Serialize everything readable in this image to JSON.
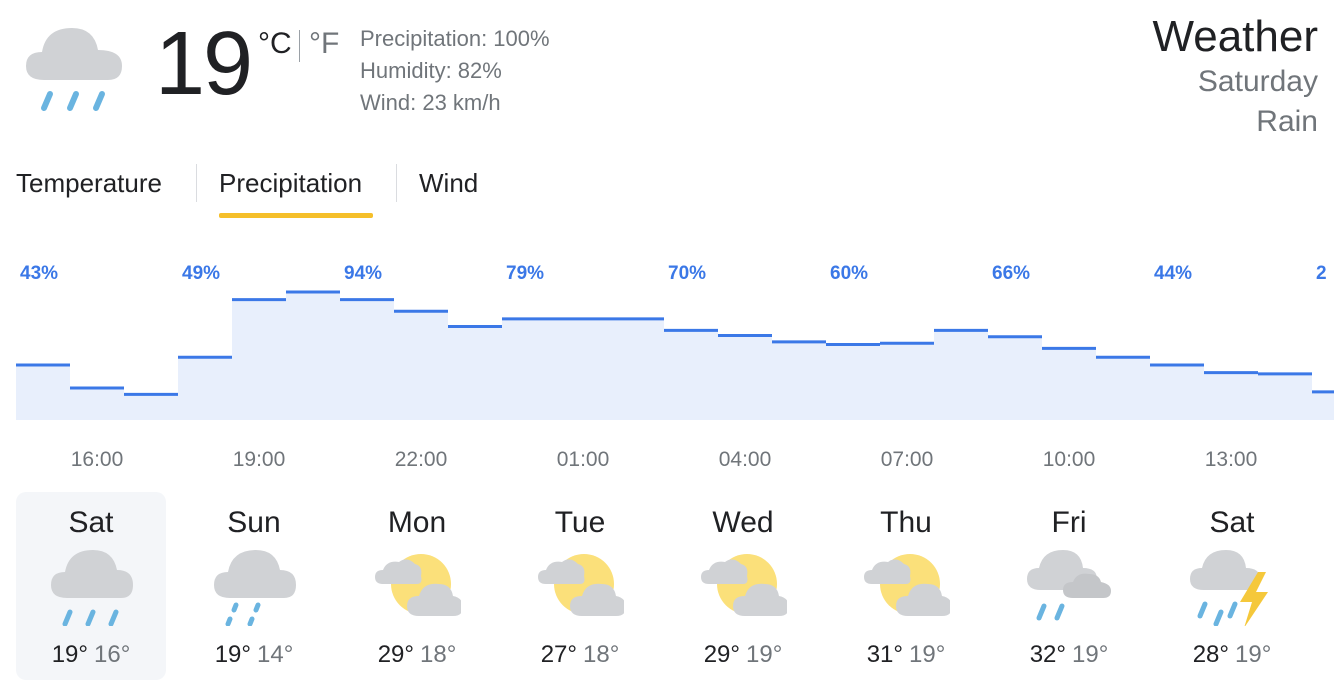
{
  "current": {
    "temperature": "19",
    "unit_c": "°C",
    "unit_f": "°F",
    "details": {
      "precipitation": "Precipitation: 100%",
      "humidity": "Humidity: 82%",
      "wind": "Wind: 23 km/h"
    },
    "icon": "rain-icon"
  },
  "header": {
    "title": "Weather",
    "day": "Saturday",
    "condition": "Rain"
  },
  "tabs": [
    {
      "label": "Temperature",
      "active": false
    },
    {
      "label": "Precipitation",
      "active": true
    },
    {
      "label": "Wind",
      "active": false
    }
  ],
  "colors": {
    "accent": "#f5bf2a",
    "chart_line": "#3b78e7",
    "chart_fill": "#e8effc",
    "rain": "#6ab4e0",
    "sun": "#fbe07a",
    "cloud": "#d0d2d5",
    "bolt": "#f5c83b"
  },
  "chart_data": {
    "type": "area",
    "series_label": "Precipitation (%)",
    "hours": [
      "15:00",
      "16:00",
      "17:00",
      "18:00",
      "19:00",
      "20:00",
      "21:00",
      "22:00",
      "23:00",
      "00:00",
      "01:00",
      "02:00",
      "03:00",
      "04:00",
      "05:00",
      "06:00",
      "07:00",
      "08:00",
      "09:00",
      "10:00",
      "11:00",
      "12:00",
      "13:00",
      "14:00",
      "15:00"
    ],
    "values": [
      43,
      25,
      20,
      49,
      94,
      100,
      94,
      85,
      73,
      79,
      79,
      79,
      70,
      66,
      61,
      59,
      60,
      70,
      65,
      56,
      49,
      43,
      37,
      36,
      22
    ],
    "value_labels": [
      {
        "hour": "15:00",
        "text": "43%"
      },
      {
        "hour": "18:00",
        "text": "49%"
      },
      {
        "hour": "21:00",
        "text": "94%"
      },
      {
        "hour": "00:00",
        "text": "79%"
      },
      {
        "hour": "03:00",
        "text": "70%"
      },
      {
        "hour": "06:00",
        "text": "60%"
      },
      {
        "hour": "09:00",
        "text": "66%"
      },
      {
        "hour": "12:00",
        "text": "44%"
      },
      {
        "hour": "15:00",
        "text": "2"
      }
    ],
    "x_tick_labels": [
      "16:00",
      "19:00",
      "22:00",
      "01:00",
      "04:00",
      "07:00",
      "10:00",
      "13:00"
    ],
    "ylim": [
      0,
      100
    ]
  },
  "forecast": [
    {
      "day": "Sat",
      "hi": "19°",
      "lo": "16°",
      "icon": "rain-icon",
      "selected": true
    },
    {
      "day": "Sun",
      "hi": "19°",
      "lo": "14°",
      "icon": "light-rain-icon",
      "selected": false
    },
    {
      "day": "Mon",
      "hi": "29°",
      "lo": "18°",
      "icon": "partly-cloudy-icon",
      "selected": false
    },
    {
      "day": "Tue",
      "hi": "27°",
      "lo": "18°",
      "icon": "partly-cloudy-icon",
      "selected": false
    },
    {
      "day": "Wed",
      "hi": "29°",
      "lo": "19°",
      "icon": "partly-cloudy-icon",
      "selected": false
    },
    {
      "day": "Thu",
      "hi": "31°",
      "lo": "19°",
      "icon": "partly-cloudy-icon",
      "selected": false
    },
    {
      "day": "Fri",
      "hi": "32°",
      "lo": "19°",
      "icon": "showers-clouds-icon",
      "selected": false
    },
    {
      "day": "Sat",
      "hi": "28°",
      "lo": "19°",
      "icon": "thunderstorm-icon",
      "selected": false
    }
  ]
}
